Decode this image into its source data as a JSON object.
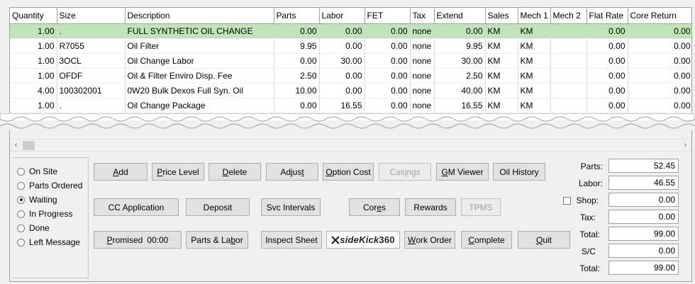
{
  "grid": {
    "columns": [
      "Quantity",
      "Size",
      "Description",
      "Parts",
      "Labor",
      "FET",
      "Tax",
      "Extend",
      "Sales",
      "Mech 1",
      "Mech 2",
      "Flat Rate",
      "Core Return"
    ],
    "rows": [
      {
        "qty": "1.00",
        "size": ".",
        "desc": "FULL SYNTHETIC OIL CHANGE",
        "parts": "0.00",
        "labor": "0.00",
        "fet": "0.00",
        "tax": "none",
        "extend": "0.00",
        "sales": "KM",
        "mech1": "KM",
        "mech2": "",
        "flat": "0.00",
        "core": "0.00"
      },
      {
        "qty": "1.00",
        "size": "R7055",
        "desc": "Oil Filter",
        "parts": "9.95",
        "labor": "0.00",
        "fet": "0.00",
        "tax": "none",
        "extend": "9.95",
        "sales": "KM",
        "mech1": "KM",
        "mech2": "",
        "flat": "0.00",
        "core": "0.00"
      },
      {
        "qty": "1.00",
        "size": "3OCL",
        "desc": "Oil Change Labor",
        "parts": "0.00",
        "labor": "30.00",
        "fet": "0.00",
        "tax": "none",
        "extend": "30.00",
        "sales": "KM",
        "mech1": "KM",
        "mech2": "",
        "flat": "0.00",
        "core": "0.00"
      },
      {
        "qty": "1.00",
        "size": "OFDF",
        "desc": "Oil & Filter Enviro Disp. Fee",
        "parts": "2.50",
        "labor": "0.00",
        "fet": "0.00",
        "tax": "none",
        "extend": "2.50",
        "sales": "KM",
        "mech1": "KM",
        "mech2": "",
        "flat": "0.00",
        "core": "0.00"
      },
      {
        "qty": "4.00",
        "size": "100302001",
        "desc": "0W20 Bulk Dexos Full Syn. Oil",
        "parts": "10.00",
        "labor": "0.00",
        "fet": "0.00",
        "tax": "none",
        "extend": "40.00",
        "sales": "KM",
        "mech1": "KM",
        "mech2": "",
        "flat": "0.00",
        "core": "0.00"
      },
      {
        "qty": "1.00",
        "size": ".",
        "desc": "Oil Change Package",
        "parts": "0.00",
        "labor": "16.55",
        "fet": "0.00",
        "tax": "none",
        "extend": "16.55",
        "sales": "KM",
        "mech1": "KM",
        "mech2": "",
        "flat": "0.00",
        "core": "0.00"
      }
    ]
  },
  "scroll": {
    "left": "‹",
    "right": "›"
  },
  "status": {
    "options": [
      "On Site",
      "Parts Ordered",
      "Waiting",
      "In Progress",
      "Done",
      "Left Message"
    ],
    "selected": "Waiting"
  },
  "buttons": {
    "add": {
      "u": "A",
      "rest": "dd"
    },
    "price_level": {
      "u": "P",
      "rest": "rice Level"
    },
    "delete": {
      "u": "D",
      "rest": "elete"
    },
    "adjust": {
      "pre": "Adjus",
      "u": "t"
    },
    "option_cost": {
      "u": "O",
      "rest": "ption Cost"
    },
    "casings": {
      "pre": "Cas",
      "u": "i",
      "rest": "ngs"
    },
    "gm_viewer": {
      "u": "G",
      "rest": "M Viewer"
    },
    "oil_history": "Oil History",
    "cc_application": "CC Application",
    "deposit": "Deposit",
    "svc_intervals": "Svc Intervals",
    "cores": {
      "pre": "Cor",
      "u": "e",
      "rest": "s"
    },
    "rewards": "Rewards",
    "tpms": "TPMS",
    "promised": {
      "u": "P",
      "rest": "romised",
      "time": "00:00"
    },
    "parts_labor": {
      "pre": "Parts & La",
      "u": "b",
      "rest": "or"
    },
    "inspect_sheet": "Inspect Sheet",
    "sidekick": {
      "a": "side",
      "b": "Kick",
      "c": "360"
    },
    "work_order": {
      "u": "W",
      "rest": "ork Order"
    },
    "complete": {
      "u": "C",
      "rest": "omplete"
    },
    "quit": {
      "u": "Q",
      "rest": "uit"
    }
  },
  "totals": {
    "parts_label": "Parts:",
    "parts": "52.45",
    "labor_label": "Labor:",
    "labor": "46.55",
    "shop_label": "Shop:",
    "shop": "0.00",
    "tax_label": "Tax:",
    "tax": "0.00",
    "total_label": "Total:",
    "total": "99.00",
    "sc_label": "S/C",
    "sc": "0.00",
    "grand_label": "Total:",
    "grand": "99.00"
  }
}
